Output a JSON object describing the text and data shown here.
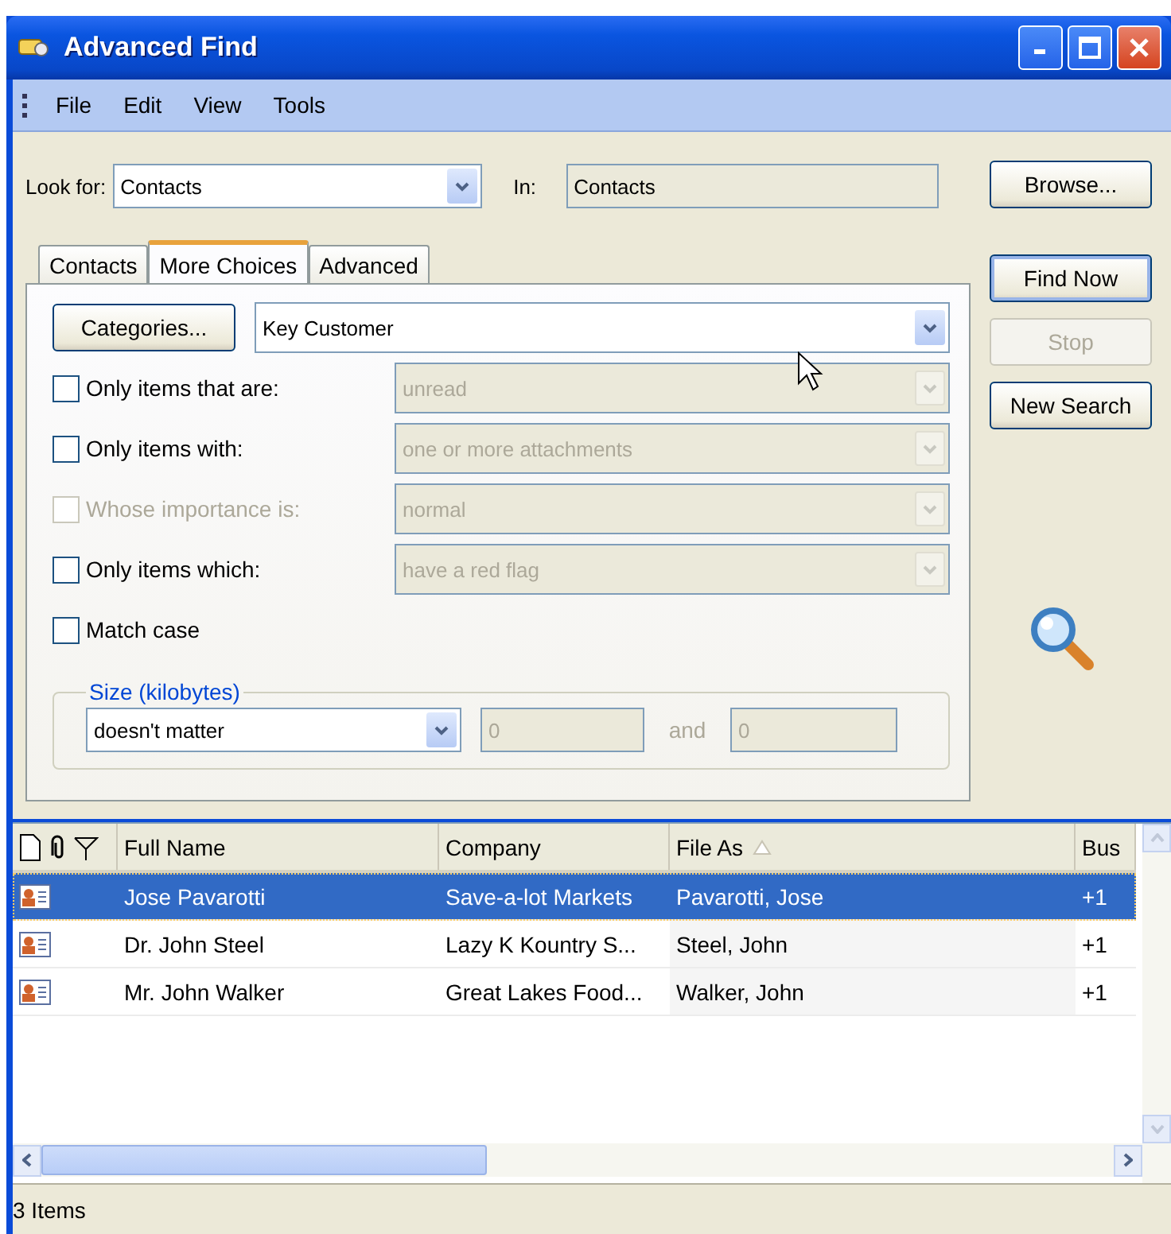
{
  "window": {
    "title": "Advanced Find"
  },
  "menu": [
    {
      "label": "File"
    },
    {
      "label": "Edit"
    },
    {
      "label": "View"
    },
    {
      "label": "Tools"
    }
  ],
  "look_for": {
    "label": "Look for:",
    "value": "Contacts"
  },
  "in": {
    "label": "In:",
    "value": "Contacts"
  },
  "buttons": [
    {
      "label": "Browse...",
      "disabled": false,
      "default": false
    },
    {
      "label": "Find Now",
      "disabled": false,
      "default": true
    },
    {
      "label": "Stop",
      "disabled": true,
      "default": false
    },
    {
      "label": "New Search",
      "disabled": false,
      "default": false
    }
  ],
  "tabs": [
    {
      "label": "Contacts",
      "selected": false
    },
    {
      "label": "More Choices",
      "selected": true
    },
    {
      "label": "Advanced",
      "selected": false
    }
  ],
  "categories": {
    "button": "Categories...",
    "value": "Key Customer"
  },
  "criteria": [
    {
      "label": "Only items that are:",
      "checked": false,
      "disabled": false,
      "value": "unread"
    },
    {
      "label": "Only items with:",
      "checked": false,
      "disabled": false,
      "value": "one or more attachments"
    },
    {
      "label": "Whose importance is:",
      "checked": false,
      "disabled": true,
      "value": "normal"
    },
    {
      "label": "Only items which:",
      "checked": false,
      "disabled": false,
      "value": "have a red flag"
    }
  ],
  "match_case": {
    "label": "Match case",
    "checked": false
  },
  "size": {
    "legend": "Size (kilobytes)",
    "value": "doesn't matter",
    "from": "0",
    "joiner": "and",
    "to": "0"
  },
  "table": {
    "columns": [
      {
        "label": "Full Name",
        "sorted": false
      },
      {
        "label": "Company",
        "sorted": false
      },
      {
        "label": "File As",
        "sorted": true
      },
      {
        "label": "Bus",
        "sorted": false
      }
    ],
    "rows": [
      {
        "selected": true,
        "cells": [
          "Jose Pavarotti",
          "Save-a-lot Markets",
          "Pavarotti, Jose",
          "+1"
        ]
      },
      {
        "selected": false,
        "cells": [
          "Dr. John Steel",
          "Lazy K Kountry S...",
          "Steel, John",
          "+1"
        ]
      },
      {
        "selected": false,
        "cells": [
          "Mr. John Walker",
          "Great Lakes Food...",
          "Walker, John",
          "+1"
        ]
      }
    ]
  },
  "status_bar": {
    "text": "3 Items"
  }
}
